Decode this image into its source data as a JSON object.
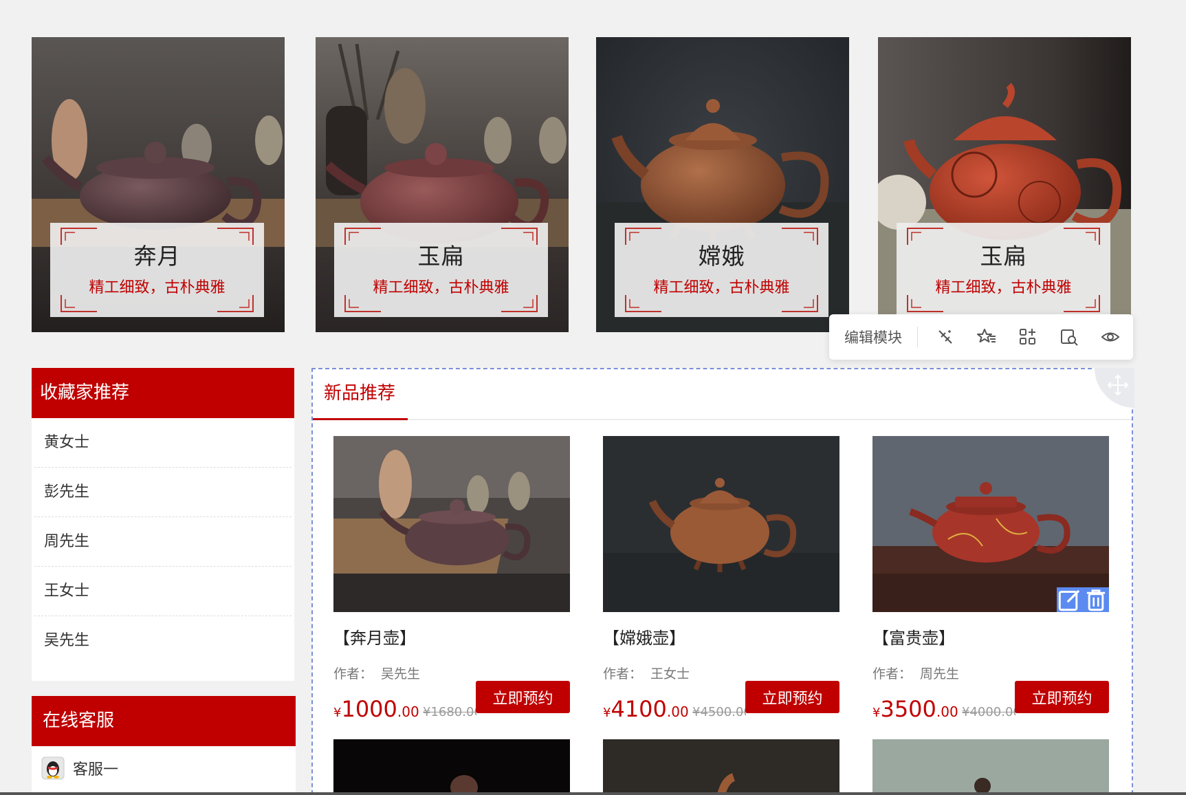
{
  "banners": [
    {
      "title": "奔月",
      "subtitle": "精工细致，古朴典雅"
    },
    {
      "title": "玉扁",
      "subtitle": "精工细致，古朴典雅"
    },
    {
      "title": "嫦娥",
      "subtitle": "精工细致，古朴典雅"
    },
    {
      "title": "玉扁",
      "subtitle": "精工细致，古朴典雅"
    }
  ],
  "toolbar": {
    "label": "编辑模块",
    "icons": [
      "magic-wand-icon",
      "star-list-icon",
      "grid-add-icon",
      "copy-search-icon",
      "eye-icon"
    ]
  },
  "collectors": {
    "title": "收藏家推荐",
    "items": [
      "黄女士",
      "彭先生",
      "周先生",
      "王女士",
      "吴先生"
    ]
  },
  "service": {
    "title": "在线客服",
    "items": [
      "客服一"
    ]
  },
  "new_products": {
    "tab": "新品推荐",
    "author_label": "作者：",
    "buy_label": "立即预约",
    "currency": "¥",
    "items": [
      {
        "name": "【奔月壶】",
        "author": "吴先生",
        "price_int": "1000",
        "price_dec": ".00",
        "old_price": "¥1680.00"
      },
      {
        "name": "【嫦娥壶】",
        "author": "王女士",
        "price_int": "4100",
        "price_dec": ".00",
        "old_price": "¥4500.00"
      },
      {
        "name": "【富贵壶】",
        "author": "周先生",
        "price_int": "3500",
        "price_dec": ".00",
        "old_price": "¥4000.00"
      }
    ]
  },
  "colors": {
    "accent": "#c00000",
    "selection_border": "#7b8fd8",
    "action_blue": "#5b8bf0"
  }
}
